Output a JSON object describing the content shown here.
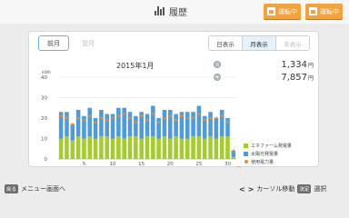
{
  "header": {
    "title": "履歴",
    "buttons": [
      {
        "label": "運転中",
        "icon": "panel-icon"
      },
      {
        "label": "運転中",
        "icon": "panel-icon"
      }
    ]
  },
  "nav": {
    "prev_label": "前月",
    "next_label": "翌月",
    "views": [
      {
        "label": "日表示",
        "state": "normal"
      },
      {
        "label": "月表示",
        "state": "active"
      },
      {
        "label": "年表示",
        "state": "disabled"
      }
    ]
  },
  "period_title": "2015年1月",
  "summary": [
    {
      "icon_label": "買",
      "value": "1,334",
      "unit": "円"
    },
    {
      "icon_label": "売",
      "value": "7,857",
      "unit": "円"
    }
  ],
  "legend": [
    {
      "label": "エネファーム発電量",
      "color": "#a4cc2c",
      "shape": "square"
    },
    {
      "label": "太陽光発電量",
      "color": "#4f9ad8",
      "shape": "square"
    },
    {
      "label": "使用電力量",
      "color": "#f08a34",
      "shape": "dot"
    }
  ],
  "footer": {
    "back_key": "戻る",
    "back_label": "メニュー画面へ",
    "nav_label": "カーソル移動",
    "decide_key": "決定",
    "decide_label": "選択"
  },
  "chart_data": {
    "type": "bar",
    "ylabel": "kWh",
    "xlabel": "日",
    "ylim": [
      0,
      40
    ],
    "yticks": [
      0,
      10,
      20,
      30,
      40
    ],
    "xticks": [
      5,
      10,
      15,
      20,
      25,
      30
    ],
    "categories": [
      1,
      2,
      3,
      4,
      5,
      6,
      7,
      8,
      9,
      10,
      11,
      12,
      13,
      14,
      15,
      16,
      17,
      18,
      19,
      20,
      21,
      22,
      23,
      24,
      25,
      26,
      27,
      28,
      29,
      30,
      31
    ],
    "series": [
      {
        "name": "エネファーム発電量",
        "values": [
          10,
          11,
          9,
          11,
          10,
          11,
          10,
          11,
          11,
          10,
          11,
          10,
          11,
          11,
          10,
          11,
          11,
          10,
          11,
          10,
          11,
          10,
          10,
          11,
          11,
          10,
          11,
          10,
          11,
          11,
          1
        ]
      },
      {
        "name": "太陽光発電量",
        "values": [
          13,
          12,
          8,
          13,
          11,
          14,
          10,
          13,
          11,
          12,
          14,
          15,
          12,
          10,
          13,
          11,
          15,
          10,
          13,
          14,
          11,
          13,
          13,
          12,
          15,
          11,
          12,
          10,
          13,
          9,
          3
        ]
      },
      {
        "name": "使用電力量",
        "values": [
          21,
          20,
          17,
          20,
          19,
          21,
          18,
          20,
          19,
          20,
          21,
          22,
          20,
          18,
          21,
          19,
          22,
          18,
          20,
          21,
          19,
          21,
          20,
          20,
          22,
          19,
          20,
          20,
          21,
          18,
          4
        ]
      }
    ]
  }
}
